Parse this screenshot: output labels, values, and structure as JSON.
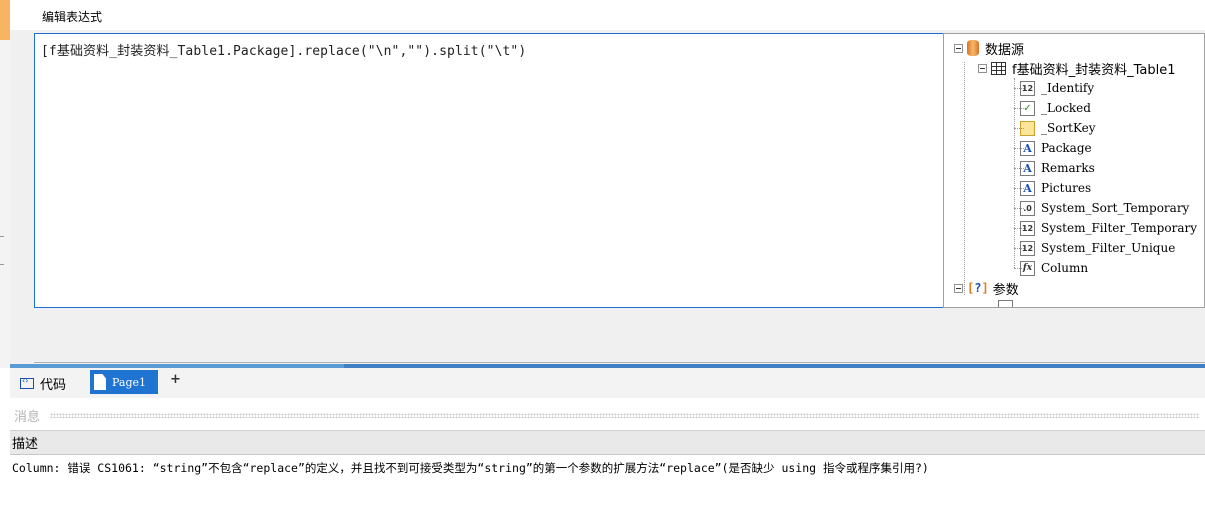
{
  "dialog": {
    "title": "编辑表达式",
    "expression": "[f基础资料_封装资料_Table1.Package].replace(\"\\n\",\"\").split(\"\\t\")"
  },
  "tree": {
    "datasource_label": "数据源",
    "table_label": "f基础资料_封装资料_Table1",
    "fields": [
      {
        "name": "_Identify",
        "icon": "number-icon",
        "badge": "12"
      },
      {
        "name": "_Locked",
        "icon": "checkbox-icon",
        "badge": "✓"
      },
      {
        "name": "_SortKey",
        "icon": "key-icon",
        "badge": ""
      },
      {
        "name": "Package",
        "icon": "text-icon",
        "badge": "A"
      },
      {
        "name": "Remarks",
        "icon": "text-icon",
        "badge": "A"
      },
      {
        "name": "Pictures",
        "icon": "text-icon",
        "badge": "A"
      },
      {
        "name": "System_Sort_Temporary",
        "icon": "decimal-icon",
        "badge": ".0"
      },
      {
        "name": "System_Filter_Temporary",
        "icon": "number-icon",
        "badge": "12"
      },
      {
        "name": "System_Filter_Unique",
        "icon": "number-icon",
        "badge": "12"
      },
      {
        "name": "Column",
        "icon": "function-icon",
        "badge": "fx"
      }
    ],
    "params_label": "参数"
  },
  "tabs": {
    "code_label": "代码",
    "page_label": "Page1",
    "add_label": "+"
  },
  "messages": {
    "header_label": "消息",
    "column_header": "描述",
    "rows": [
      "Column: 错误 CS1061: “string”不包含“replace”的定义，并且找不到可接受类型为“string”的第一个参数的扩展方法“replace”(是否缺少 using 指令或程序集引用?)"
    ]
  }
}
